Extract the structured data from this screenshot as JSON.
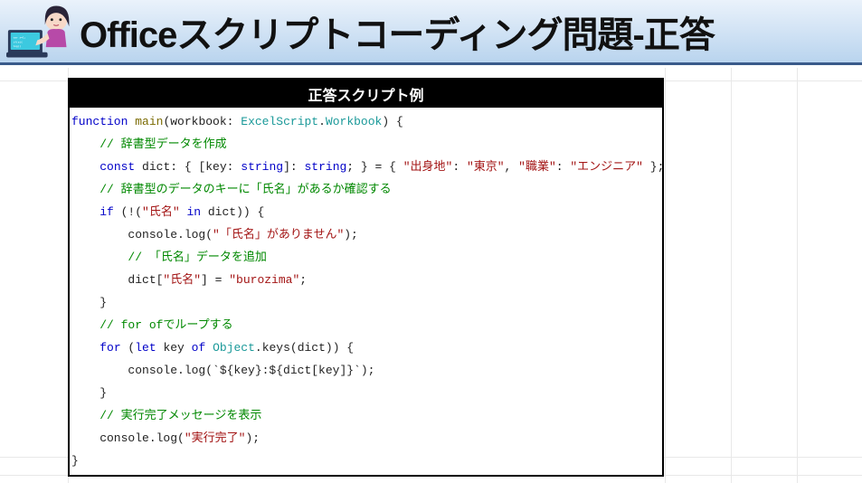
{
  "header": {
    "title": "Officeスクリプトコーディング問題-正答"
  },
  "code": {
    "header": "正答スクリプト例",
    "lines": [
      [
        {
          "t": "function",
          "c": "kw"
        },
        {
          "t": " ",
          "c": "plain"
        },
        {
          "t": "main",
          "c": "fn"
        },
        {
          "t": "(workbook: ",
          "c": "plain"
        },
        {
          "t": "ExcelScript",
          "c": "type"
        },
        {
          "t": ".",
          "c": "plain"
        },
        {
          "t": "Workbook",
          "c": "type"
        },
        {
          "t": ") {",
          "c": "plain"
        }
      ],
      [
        {
          "t": "    ",
          "c": "plain"
        },
        {
          "t": "// 辞書型データを作成",
          "c": "com"
        }
      ],
      [
        {
          "t": "    ",
          "c": "plain"
        },
        {
          "t": "const",
          "c": "kw"
        },
        {
          "t": " dict: { [key: ",
          "c": "plain"
        },
        {
          "t": "string",
          "c": "kw"
        },
        {
          "t": "]: ",
          "c": "plain"
        },
        {
          "t": "string",
          "c": "kw"
        },
        {
          "t": "; } = { ",
          "c": "plain"
        },
        {
          "t": "\"出身地\"",
          "c": "str"
        },
        {
          "t": ": ",
          "c": "plain"
        },
        {
          "t": "\"東京\"",
          "c": "str"
        },
        {
          "t": ", ",
          "c": "plain"
        },
        {
          "t": "\"職業\"",
          "c": "str"
        },
        {
          "t": ": ",
          "c": "plain"
        },
        {
          "t": "\"エンジニア\"",
          "c": "str"
        },
        {
          "t": " };",
          "c": "plain"
        }
      ],
      [
        {
          "t": "    ",
          "c": "plain"
        },
        {
          "t": "// 辞書型のデータのキーに「氏名」があるか確認する",
          "c": "com"
        }
      ],
      [
        {
          "t": "    ",
          "c": "plain"
        },
        {
          "t": "if",
          "c": "kw"
        },
        {
          "t": " (!(",
          "c": "plain"
        },
        {
          "t": "\"氏名\"",
          "c": "str"
        },
        {
          "t": " ",
          "c": "plain"
        },
        {
          "t": "in",
          "c": "kw"
        },
        {
          "t": " dict)) {",
          "c": "plain"
        }
      ],
      [
        {
          "t": "        console.log(",
          "c": "plain"
        },
        {
          "t": "\"「氏名」がありません\"",
          "c": "str"
        },
        {
          "t": ");",
          "c": "plain"
        }
      ],
      [
        {
          "t": "        ",
          "c": "plain"
        },
        {
          "t": "// 「氏名」データを追加",
          "c": "com"
        }
      ],
      [
        {
          "t": "        dict[",
          "c": "plain"
        },
        {
          "t": "\"氏名\"",
          "c": "str"
        },
        {
          "t": "] = ",
          "c": "plain"
        },
        {
          "t": "\"burozima\"",
          "c": "str"
        },
        {
          "t": ";",
          "c": "plain"
        }
      ],
      [
        {
          "t": "    }",
          "c": "plain"
        }
      ],
      [
        {
          "t": "    ",
          "c": "plain"
        },
        {
          "t": "// for ofでループする",
          "c": "com"
        }
      ],
      [
        {
          "t": "    ",
          "c": "plain"
        },
        {
          "t": "for",
          "c": "kw"
        },
        {
          "t": " (",
          "c": "plain"
        },
        {
          "t": "let",
          "c": "kw"
        },
        {
          "t": " key ",
          "c": "plain"
        },
        {
          "t": "of",
          "c": "kw"
        },
        {
          "t": " ",
          "c": "plain"
        },
        {
          "t": "Object",
          "c": "type"
        },
        {
          "t": ".keys(dict)) {",
          "c": "plain"
        }
      ],
      [
        {
          "t": "        console.log(`${key}:${dict[key]}`);",
          "c": "plain"
        }
      ],
      [
        {
          "t": "    }",
          "c": "plain"
        }
      ],
      [
        {
          "t": "    ",
          "c": "plain"
        },
        {
          "t": "// 実行完了メッセージを表示",
          "c": "com"
        }
      ],
      [
        {
          "t": "    console.log(",
          "c": "plain"
        },
        {
          "t": "\"実行完了\"",
          "c": "str"
        },
        {
          "t": ");",
          "c": "plain"
        }
      ],
      [
        {
          "t": "}",
          "c": "plain"
        }
      ]
    ]
  }
}
